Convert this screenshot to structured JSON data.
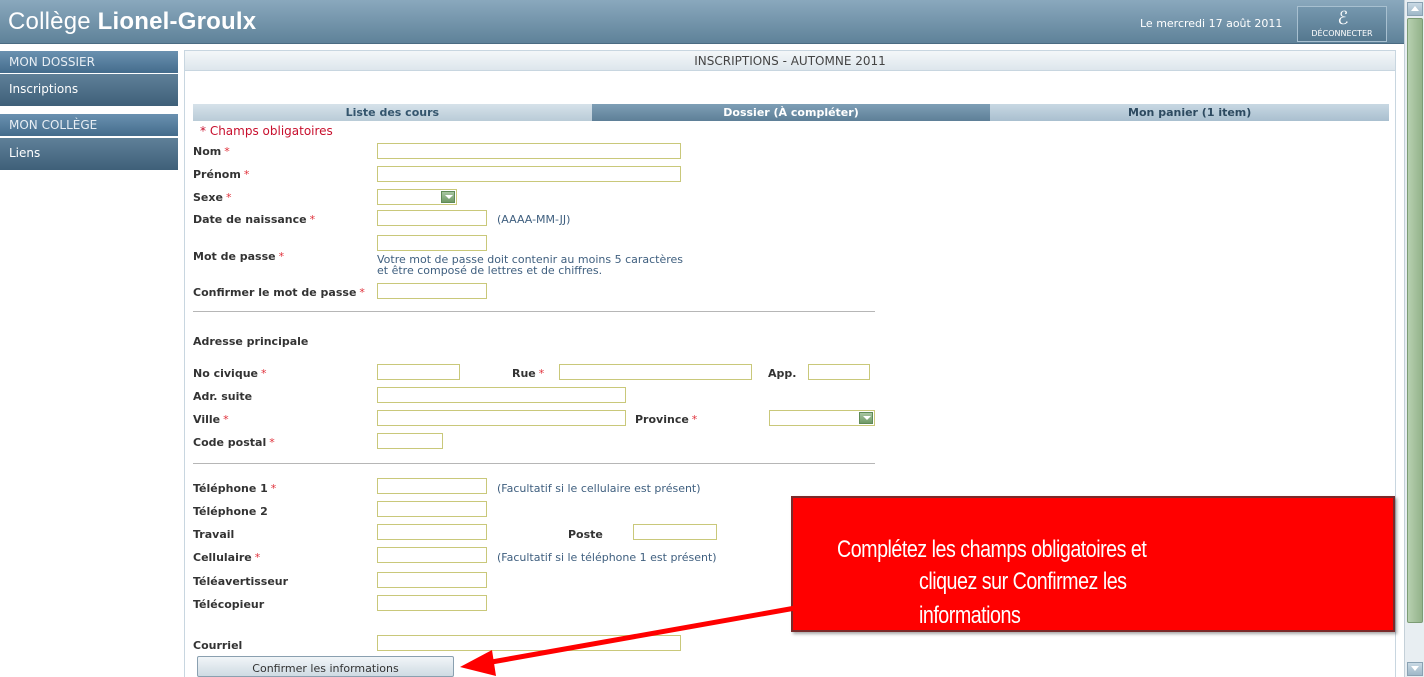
{
  "header": {
    "logo_prefix": "Collège ",
    "logo_bold": "Lionel-Groulx",
    "date": "Le mercredi 17 août 2011",
    "logout_label": "DÉCONNECTER",
    "logout_icon": "script-e-icon"
  },
  "sidebar": {
    "sections": [
      {
        "title": "MON DOSSIER",
        "items": [
          "Inscriptions"
        ]
      },
      {
        "title": "MON COLLÈGE",
        "items": [
          "Liens"
        ]
      }
    ]
  },
  "panel": {
    "title": "INSCRIPTIONS - AUTOMNE 2011",
    "tabs": [
      "Liste des cours",
      "Dossier (À compléter)",
      "Mon panier (1 item)"
    ],
    "required_note": "* Champs obligatoires"
  },
  "form": {
    "required_mark": "*",
    "nom": "Nom",
    "prenom": "Prénom",
    "sexe": "Sexe",
    "date_naissance": "Date de naissance",
    "date_hint": "(AAAA-MM-JJ)",
    "mot_de_passe": "Mot de passe",
    "password_hint_1": "Votre mot de passe doit contenir au moins 5 caractères",
    "password_hint_2": "et être composé de lettres et de chiffres.",
    "confirmer_mdp": "Confirmer le mot de passe",
    "adresse_principale": "Adresse principale",
    "no_civique": "No civique",
    "rue": "Rue",
    "app": "App.",
    "adr_suite": "Adr. suite",
    "ville": "Ville",
    "province": "Province",
    "code_postal": "Code postal",
    "telephone1": "Téléphone 1",
    "telephone1_hint": "(Facultatif si le cellulaire est présent)",
    "telephone2": "Téléphone 2",
    "travail": "Travail",
    "poste": "Poste",
    "cellulaire": "Cellulaire",
    "cellulaire_hint": "(Facultatif si le téléphone 1 est présent)",
    "teleavertisseur": "Téléavertisseur",
    "telecopieur": "Télécopieur",
    "courriel": "Courriel",
    "confirm_button": "Confirmer les informations"
  },
  "callout": {
    "line1": "Complétez les champs obligatoires et",
    "line2": "cliquez sur Confirmez les",
    "line3": "informations",
    "color": "#ff0000"
  },
  "colors": {
    "header": "#6f90a7",
    "sidebar": "#4e708a",
    "required": "#e0303a",
    "field_border": "#c9c87a"
  }
}
